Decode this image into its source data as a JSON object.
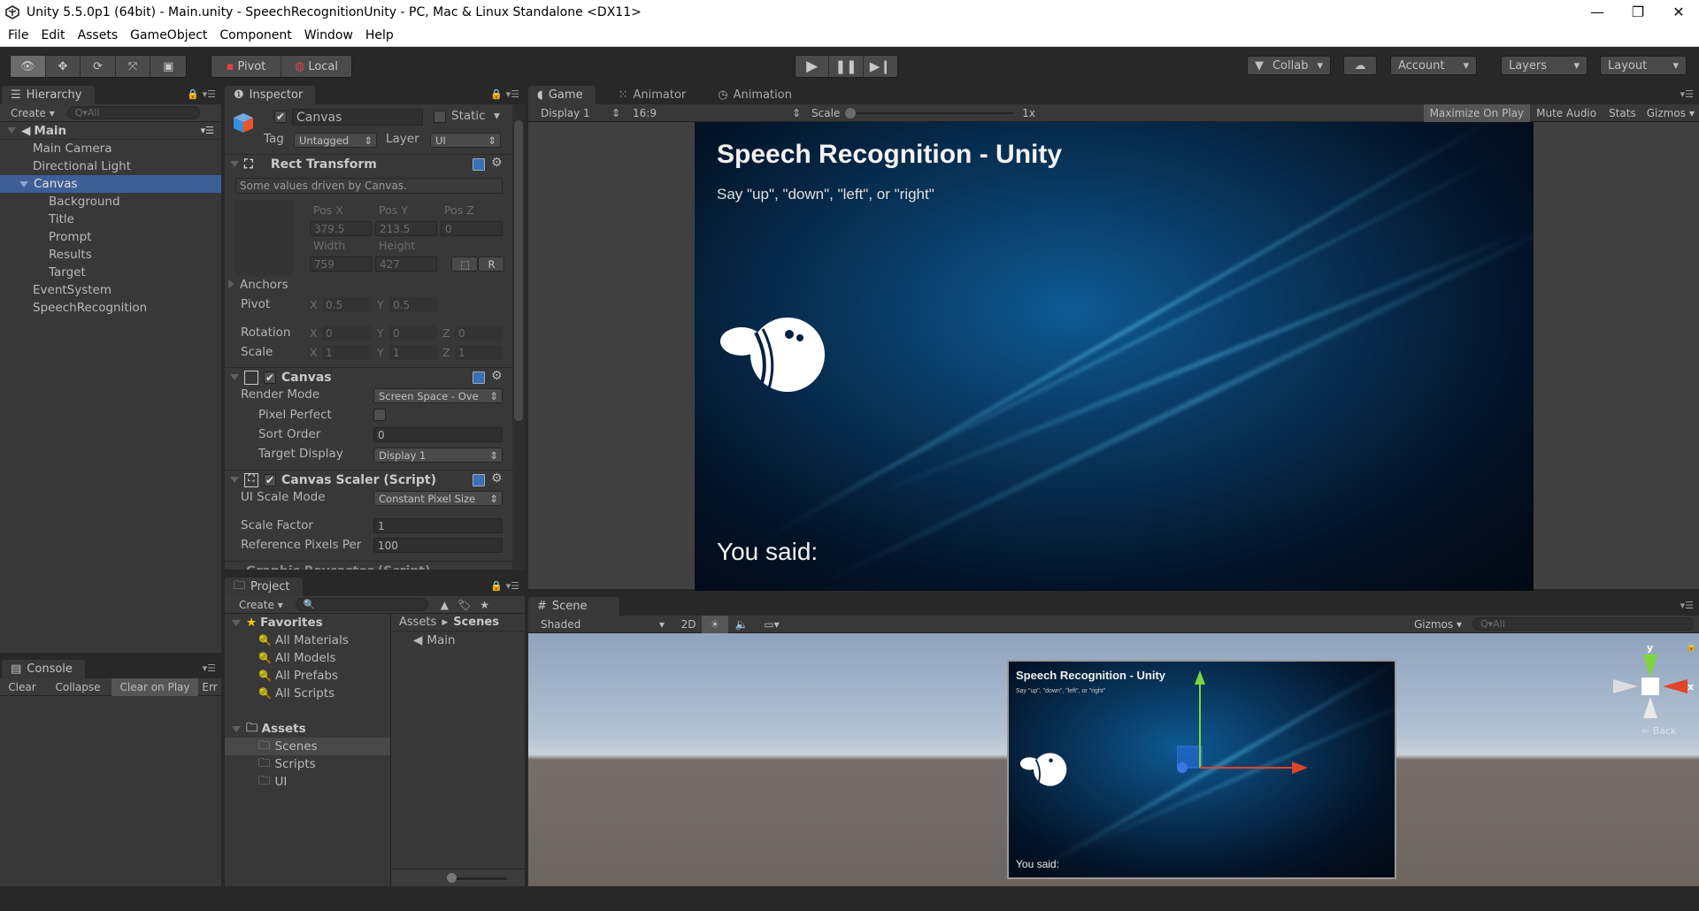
{
  "window": {
    "title": "Unity 5.5.0p1 (64bit) - Main.unity - SpeechRecognitionUnity - PC, Mac & Linux Standalone <DX11>",
    "controls": {
      "minimize": "—",
      "maximize": "❐",
      "close": "✕"
    }
  },
  "menu": [
    "File",
    "Edit",
    "Assets",
    "GameObject",
    "Component",
    "Window",
    "Help"
  ],
  "toolbar": {
    "tools": [
      "hand-eye",
      "move",
      "rotate",
      "scale",
      "rect"
    ],
    "pivot_label": "Pivot",
    "local_label": "Local",
    "collab_label": "Collab",
    "account_label": "Account",
    "layers_label": "Layers",
    "layout_label": "Layout"
  },
  "hierarchy": {
    "tab_label": "Hierarchy",
    "create_label": "Create",
    "search_placeholder": "Q▾All",
    "scene_name": "Main",
    "items": [
      {
        "label": "Main Camera",
        "depth": 1
      },
      {
        "label": "Directional Light",
        "depth": 1
      },
      {
        "label": "Canvas",
        "depth": 1,
        "selected": true,
        "expanded": true
      },
      {
        "label": "Background",
        "depth": 2
      },
      {
        "label": "Title",
        "depth": 2
      },
      {
        "label": "Prompt",
        "depth": 2
      },
      {
        "label": "Results",
        "depth": 2
      },
      {
        "label": "Target",
        "depth": 2
      },
      {
        "label": "EventSystem",
        "depth": 1
      },
      {
        "label": "SpeechRecognition",
        "depth": 1
      }
    ]
  },
  "inspector": {
    "tab_label": "Inspector",
    "object_name": "Canvas",
    "active": true,
    "static_label": "Static",
    "tag_label": "Tag",
    "tag_value": "Untagged",
    "layer_label": "Layer",
    "layer_value": "UI",
    "rect_transform": {
      "title": "Rect Transform",
      "note": "Some values driven by Canvas.",
      "pos_labels": [
        "Pos X",
        "Pos Y",
        "Pos Z"
      ],
      "pos_values": [
        "379.5",
        "213.5",
        "0"
      ],
      "size_labels": [
        "Width",
        "Height"
      ],
      "size_values": [
        "759",
        "427"
      ],
      "r_button": "R",
      "anchors_label": "Anchors",
      "pivot_label": "Pivot",
      "pivot": {
        "x": "0.5",
        "y": "0.5"
      },
      "rotation_label": "Rotation",
      "rotation": {
        "x": "0",
        "y": "0",
        "z": "0"
      },
      "scale_label": "Scale",
      "scale": {
        "x": "1",
        "y": "1",
        "z": "1"
      }
    },
    "canvas": {
      "title": "Canvas",
      "enabled": true,
      "render_mode_label": "Render Mode",
      "render_mode_value": "Screen Space - Ove",
      "pixel_perfect_label": "Pixel Perfect",
      "pixel_perfect": false,
      "sort_order_label": "Sort Order",
      "sort_order_value": "0",
      "target_display_label": "Target Display",
      "target_display_value": "Display 1"
    },
    "canvas_scaler": {
      "title": "Canvas Scaler (Script)",
      "enabled": true,
      "ui_scale_mode_label": "UI Scale Mode",
      "ui_scale_mode_value": "Constant Pixel Size",
      "scale_factor_label": "Scale Factor",
      "scale_factor_value": "1",
      "ref_pixels_label": "Reference Pixels Per",
      "ref_pixels_value": "100"
    },
    "next_component_partial": "Graphic Raycaster (Script)"
  },
  "game": {
    "tabs": [
      "Game",
      "Animator",
      "Animation"
    ],
    "display_value": "Display 1",
    "aspect_value": "16:9",
    "scale_label": "Scale",
    "scale_value": "1x",
    "scale_fraction": 0.0,
    "maximize_on_play": "Maximize On Play",
    "mute_audio": "Mute Audio",
    "stats": "Stats",
    "gizmos": "Gizmos",
    "title_text": "Speech Recognition - Unity",
    "prompt_text": "Say \"up\", \"down\", \"left\", or \"right\"",
    "result_text": "You said:"
  },
  "scene": {
    "tab_label": "Scene",
    "shading_value": "Shaded",
    "mode_2d": "2D",
    "gizmos_label": "Gizmos",
    "search_placeholder": "Q▾All",
    "gizmo_axes": {
      "y": "y",
      "x": "x",
      "back": "Back"
    },
    "preview_title": "Speech Recognition - Unity",
    "preview_prompt": "Say \"up\", \"down\", \"left\", or \"right\"",
    "preview_result": "You said:"
  },
  "project": {
    "tab_label": "Project",
    "create_label": "Create",
    "favorites_label": "Favorites",
    "favorites": [
      "All Materials",
      "All Models",
      "All Prefabs",
      "All Scripts"
    ],
    "assets_label": "Assets",
    "folders": [
      {
        "label": "Scenes",
        "selected": true
      },
      {
        "label": "Scripts"
      },
      {
        "label": "UI"
      }
    ],
    "breadcrumb": [
      "Assets",
      "Scenes"
    ],
    "files": [
      "Main"
    ]
  },
  "console": {
    "tab_label": "Console",
    "buttons": [
      "Clear",
      "Collapse",
      "Clear on Play",
      "Err"
    ]
  }
}
